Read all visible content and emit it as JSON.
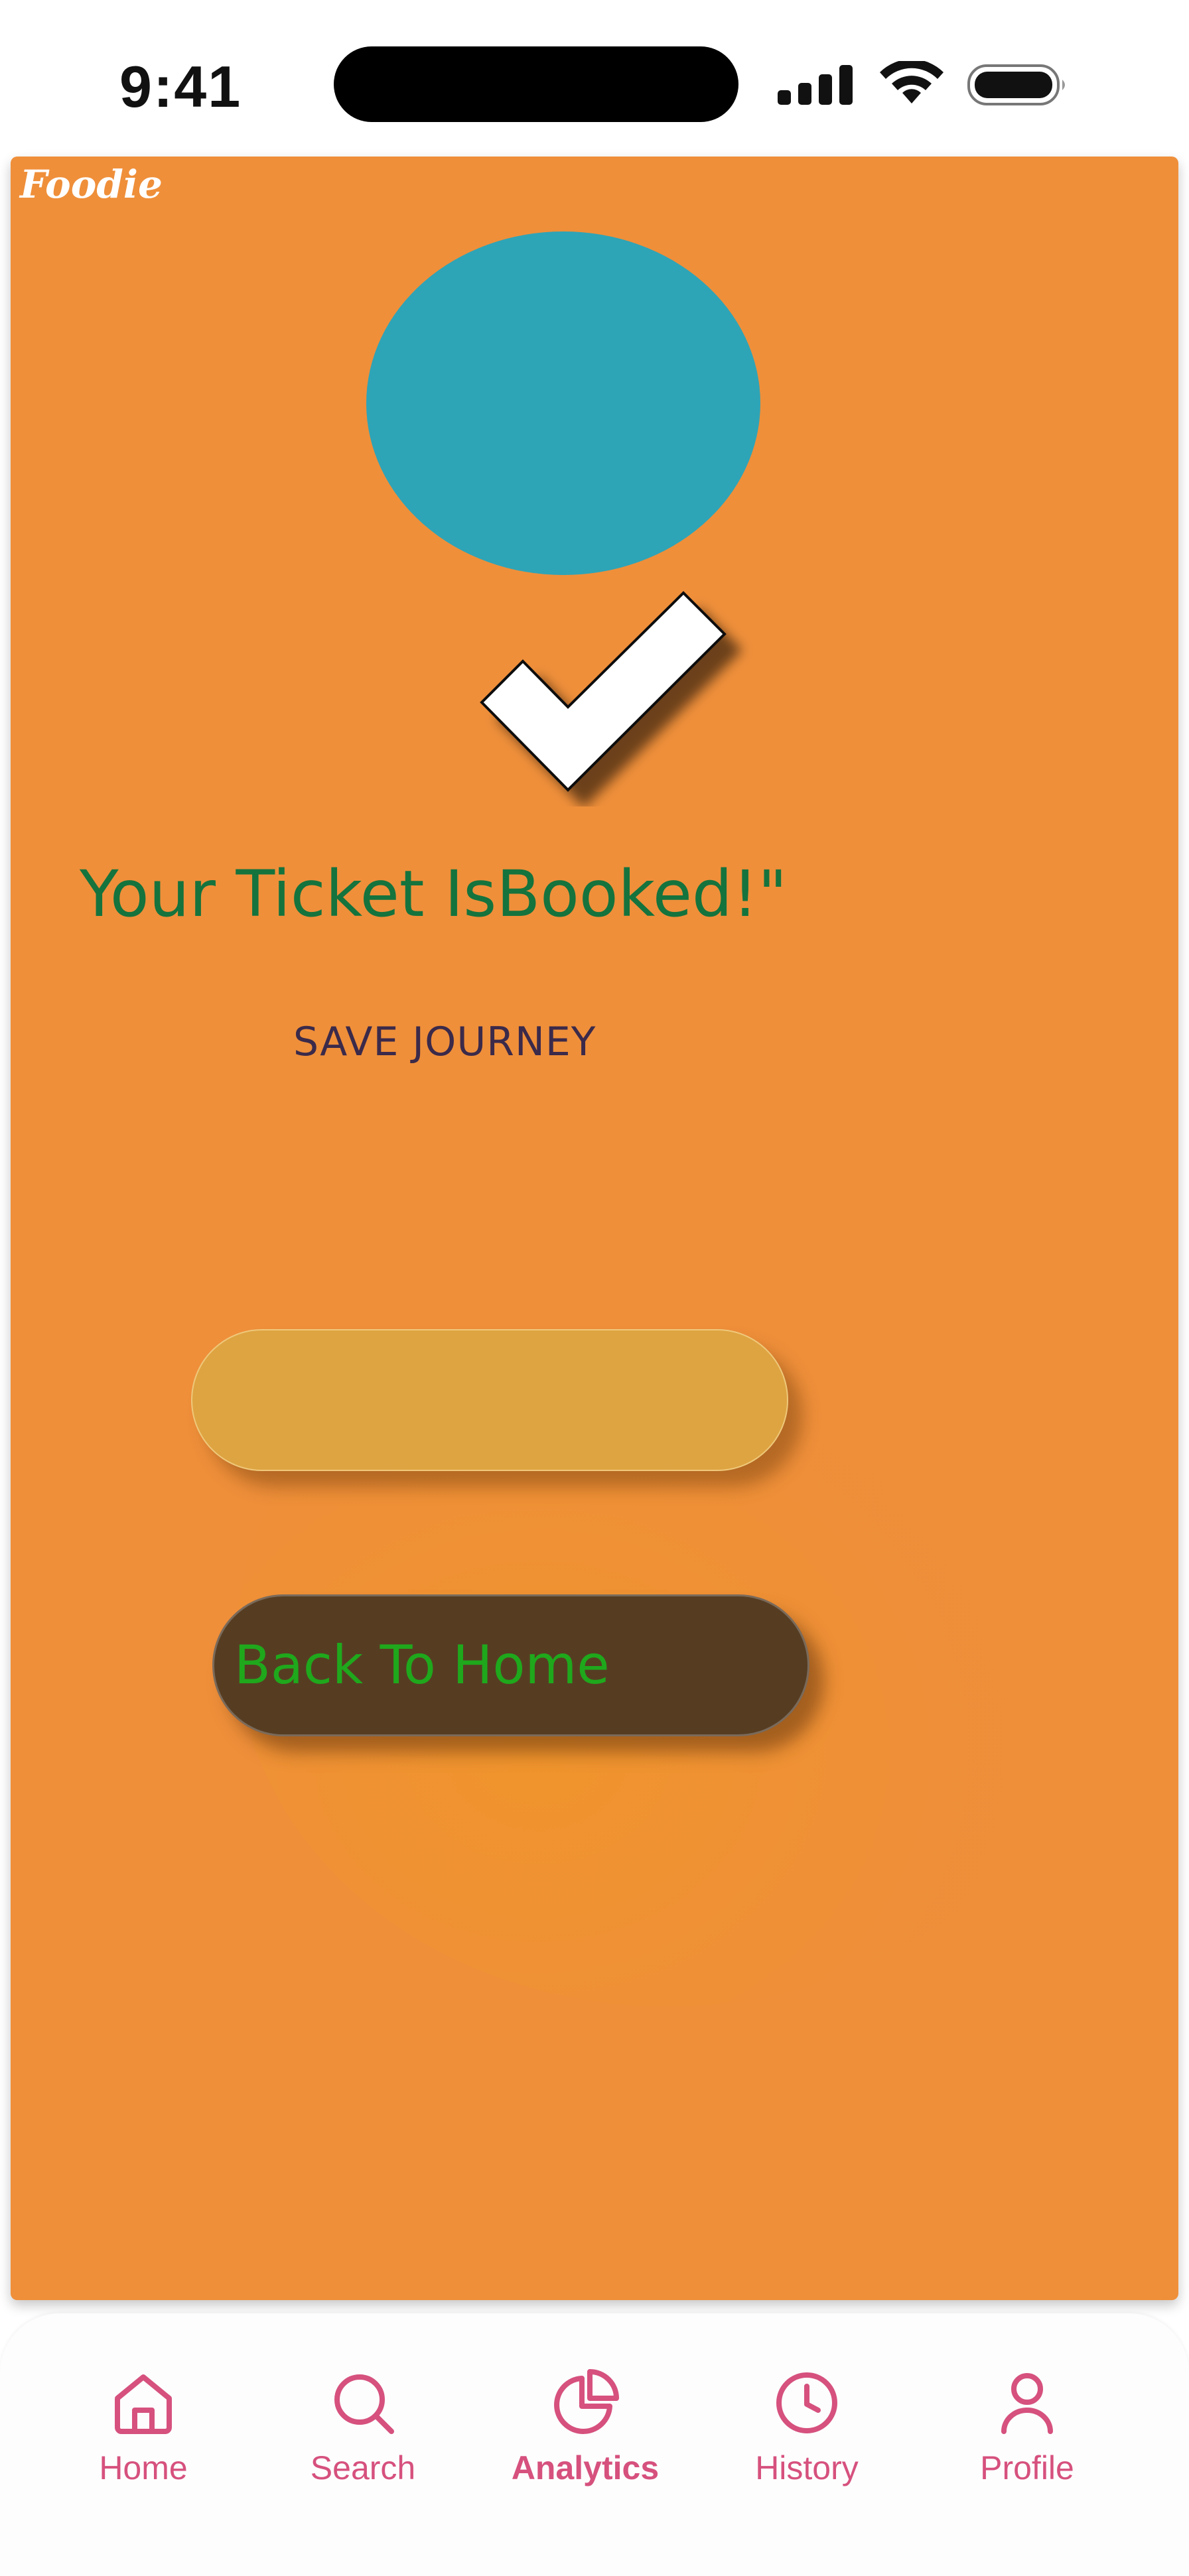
{
  "status_bar": {
    "time": "9:41"
  },
  "app": {
    "brand": "Foodie"
  },
  "confirmation": {
    "title": "Your Ticket IsBooked!\"",
    "subtitle": "SAVE JOURNEY",
    "primary_button_label": "",
    "back_home_label": "Back To Home"
  },
  "bottom_nav": {
    "items": [
      {
        "label": "Home",
        "icon": "home-icon"
      },
      {
        "label": "Search",
        "icon": "search-icon"
      },
      {
        "label": "Analytics",
        "icon": "pie-chart-icon"
      },
      {
        "label": "History",
        "icon": "clock-icon"
      },
      {
        "label": "Profile",
        "icon": "user-icon"
      }
    ],
    "active_index": 2
  },
  "colors": {
    "card_background": "#ef8f3a",
    "teal_circle": "#2ea4b7",
    "title_text": "#15733d",
    "subtitle_text": "#3b2a4a",
    "blank_button": "#dea441",
    "home_button": "#563d22",
    "home_button_text": "#1fa81c",
    "nav_accent": "#d6517d"
  }
}
